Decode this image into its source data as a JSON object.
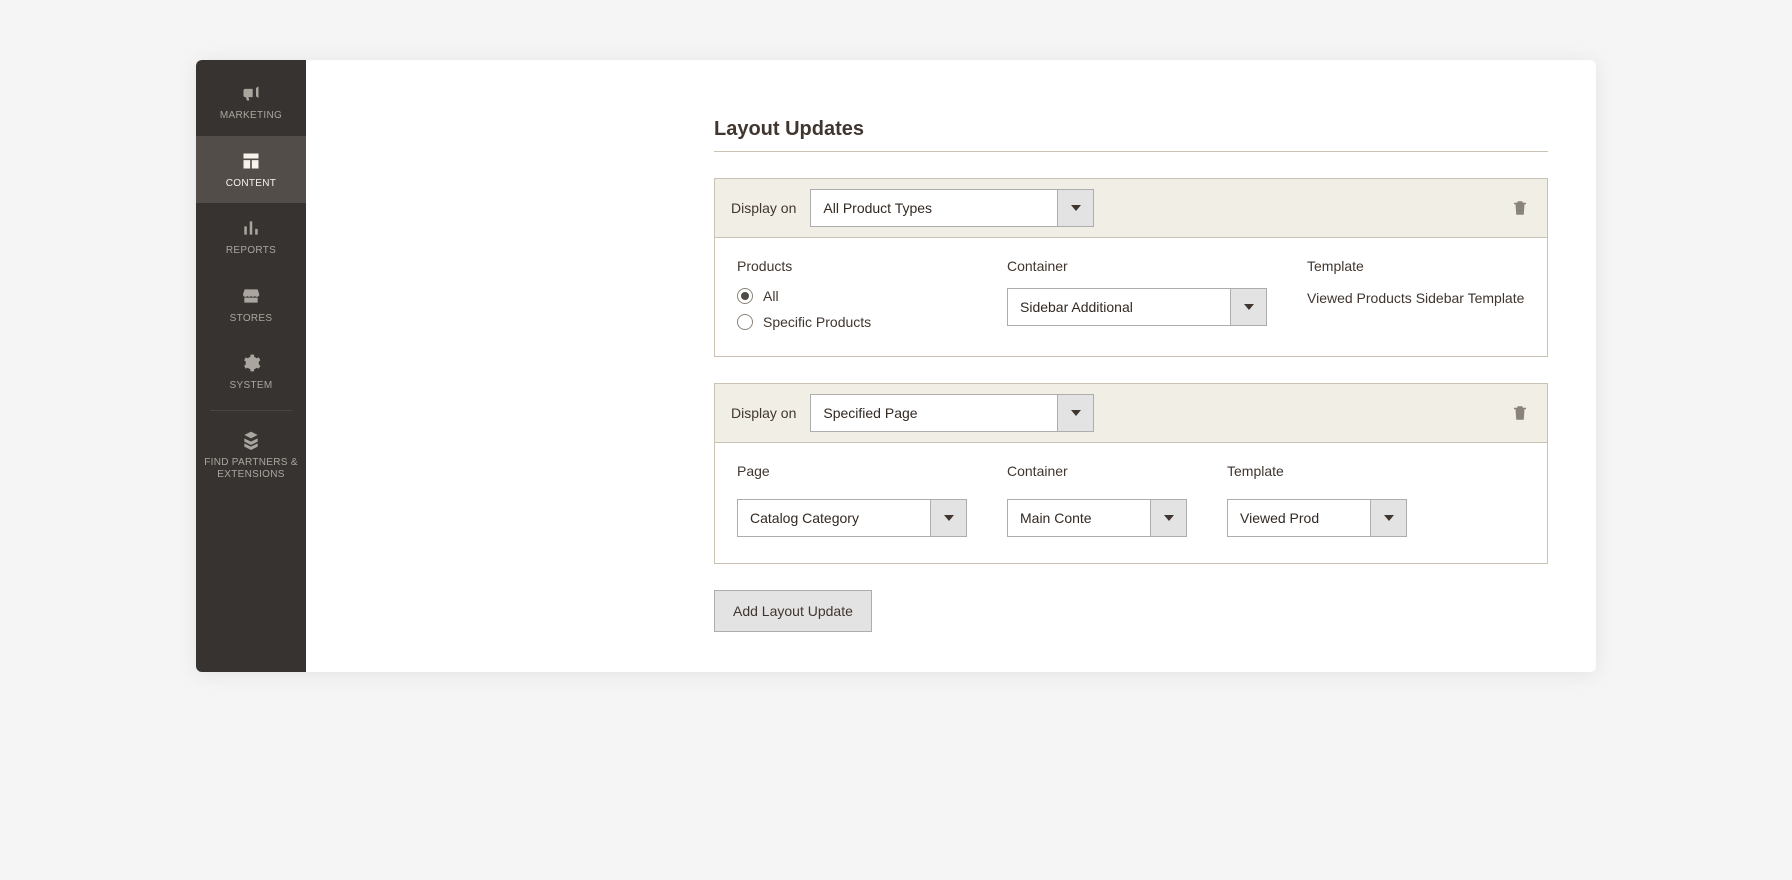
{
  "sidebar": {
    "items": [
      {
        "label": "MARKETING"
      },
      {
        "label": "CONTENT"
      },
      {
        "label": "REPORTS"
      },
      {
        "label": "STORES"
      },
      {
        "label": "SYSTEM"
      },
      {
        "label": "FIND PARTNERS & EXTENSIONS"
      }
    ]
  },
  "section": {
    "title": "Layout Updates"
  },
  "card1": {
    "display_on_label": "Display on",
    "display_on_value": "All Product Types",
    "products_label": "Products",
    "radio_all": "All",
    "radio_specific": "Specific Products",
    "container_label": "Container",
    "container_value": "Sidebar Additional",
    "template_label": "Template",
    "template_value": "Viewed Products Sidebar Template"
  },
  "card2": {
    "display_on_label": "Display on",
    "display_on_value": "Specified Page",
    "page_label": "Page",
    "page_value": "Catalog Category",
    "container_label": "Container",
    "container_value": "Main Conte",
    "template_label": "Template",
    "template_value": "Viewed Prod"
  },
  "buttons": {
    "add_layout_update": "Add Layout Update"
  }
}
